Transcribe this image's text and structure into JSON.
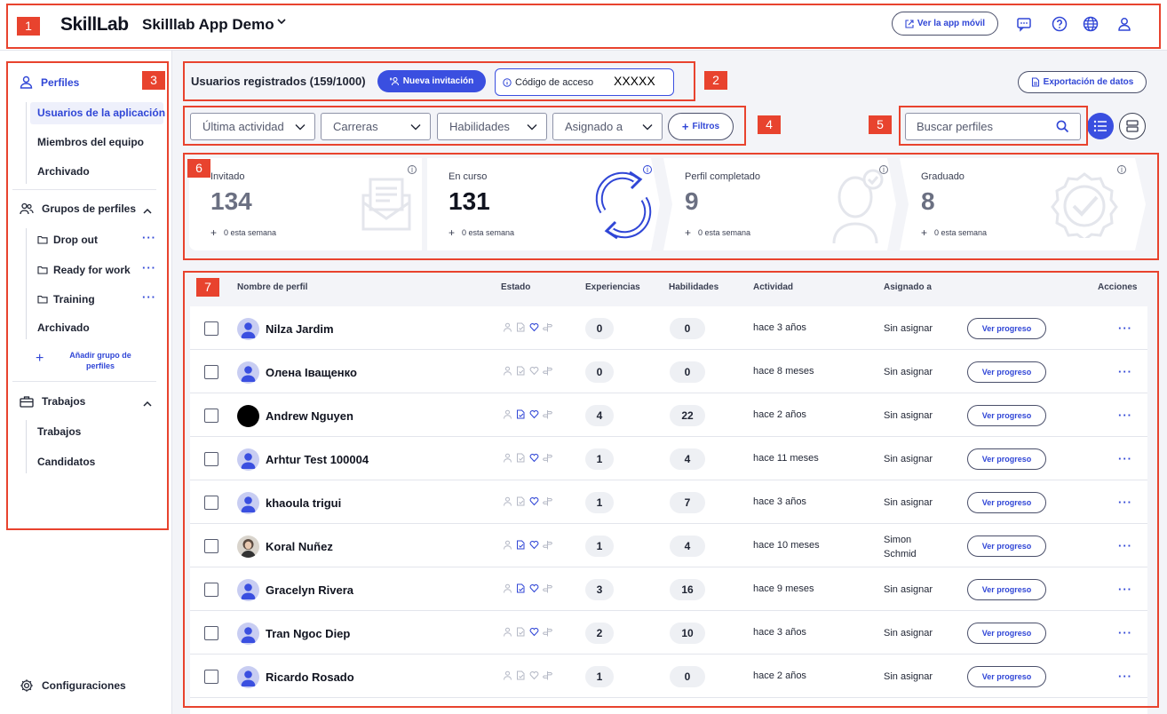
{
  "header": {
    "logo": "SkillLab",
    "app_name": "Skilllab App Demo",
    "mobile_button": "Ver la app móvil"
  },
  "markers": [
    "1",
    "2",
    "3",
    "4",
    "5",
    "6",
    "7"
  ],
  "sidebar": {
    "profiles": "Perfiles",
    "items": [
      "Usuarios de la aplicación",
      "Miembros del equipo",
      "Archivado"
    ],
    "groups_title": "Grupos de perfiles",
    "groups": [
      "Drop out",
      "Ready for work",
      "Training"
    ],
    "groups_archived": "Archivado",
    "add_group": "Añadir grupo de perfiles",
    "jobs_title": "Trabajos",
    "jobs_items": [
      "Trabajos",
      "Candidatos"
    ],
    "settings": "Configuraciones"
  },
  "toolbar": {
    "title": "Usuarios registrados (159/1000)",
    "invite": "Nueva invitación",
    "access_label": "Código de acceso",
    "access_code": "XXXXX",
    "export": "Exportación de datos"
  },
  "filters": {
    "last_activity": "Última actividad",
    "careers": "Carreras",
    "skills": "Habilidades",
    "assigned": "Asignado a",
    "filters_btn": "Filtros",
    "search_placeholder": "Buscar perfiles"
  },
  "stats": [
    {
      "label": "Invitado",
      "value": "134",
      "week": "0 esta semana"
    },
    {
      "label": "En curso",
      "value": "131",
      "week": "0 esta semana"
    },
    {
      "label": "Perfil completado",
      "value": "9",
      "week": "0 esta semana"
    },
    {
      "label": "Graduado",
      "value": "8",
      "week": "0 esta semana"
    }
  ],
  "table": {
    "headers": {
      "name": "Nombre de perfil",
      "status": "Estado",
      "experiences": "Experiencias",
      "skills": "Habilidades",
      "activity": "Actividad",
      "assigned": "Asignado a",
      "actions": "Acciones"
    },
    "progress_label": "Ver progreso",
    "rows": [
      {
        "name": "Nilza Jardim",
        "exp": "0",
        "skills": "0",
        "activity": "hace 3 años",
        "assigned": "Sin asignar"
      },
      {
        "name": "Олена Іващенко",
        "exp": "0",
        "skills": "0",
        "activity": "hace 8 meses",
        "assigned": "Sin asignar"
      },
      {
        "name": "Andrew Nguyen",
        "exp": "4",
        "skills": "22",
        "activity": "hace 2 años",
        "assigned": "Sin asignar"
      },
      {
        "name": "Arhtur Test 100004",
        "exp": "1",
        "skills": "4",
        "activity": "hace 11 meses",
        "assigned": "Sin asignar"
      },
      {
        "name": "khaoula trigui",
        "exp": "1",
        "skills": "7",
        "activity": "hace 3 años",
        "assigned": "Sin asignar"
      },
      {
        "name": "Koral Nuñez",
        "exp": "1",
        "skills": "4",
        "activity": "hace 10 meses",
        "assigned": "Simon Schmid"
      },
      {
        "name": "Gracelyn Rivera",
        "exp": "3",
        "skills": "16",
        "activity": "hace 9 meses",
        "assigned": "Sin asignar"
      },
      {
        "name": "Tran Ngoc Diep",
        "exp": "2",
        "skills": "10",
        "activity": "hace 3 años",
        "assigned": "Sin asignar"
      },
      {
        "name": "Ricardo Rosado",
        "exp": "1",
        "skills": "0",
        "activity": "hace 2 años",
        "assigned": "Sin asignar"
      }
    ]
  },
  "colors": {
    "accent": "#3a4fe0",
    "marker": "#e8432e"
  }
}
